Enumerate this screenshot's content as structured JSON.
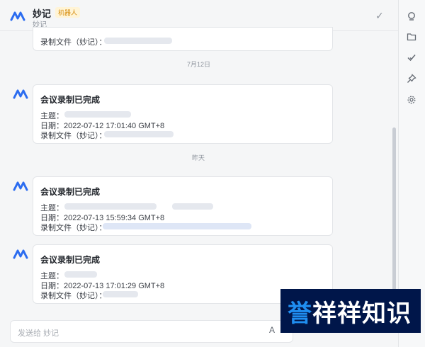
{
  "header": {
    "name": "妙记",
    "bot_tag": "机器人",
    "sub": "妙记"
  },
  "rail_icons": [
    "search-icon",
    "folder-icon",
    "check-icon",
    "pin-icon",
    "gear-icon"
  ],
  "partial_card": {
    "file_label": "录制文件（妙记）："
  },
  "messages": [
    {
      "date_label": "7月12日",
      "title": "会议录制已完成",
      "topic_label": "主题：",
      "date_field_label": "日期：",
      "date_value": "2022-07-12 17:01:40 GMT+8",
      "file_label": "录制文件（妙记）："
    },
    {
      "date_label": "昨天",
      "title": "会议录制已完成",
      "topic_label": "主题：",
      "date_field_label": "日期：",
      "date_value": "2022-07-13 15:59:34 GMT+8",
      "file_label": "录制文件（妙记）："
    },
    {
      "title": "会议录制已完成",
      "topic_label": "主题：",
      "date_field_label": "日期：",
      "date_value": "2022-07-13 17:01:29 GMT+8",
      "file_label": "录制文件（妙记）："
    }
  ],
  "input": {
    "placeholder": "发送给 妙记",
    "font_button": "A"
  },
  "brand": {
    "text": "誉祥祥知识",
    "first_char": "誉",
    "rest": "祥祥知识"
  },
  "colors": {
    "accent": "#1f8ef1",
    "brand_bg": "#00164a",
    "tag_text": "#d48806",
    "tag_bg": "#fff4d6"
  }
}
